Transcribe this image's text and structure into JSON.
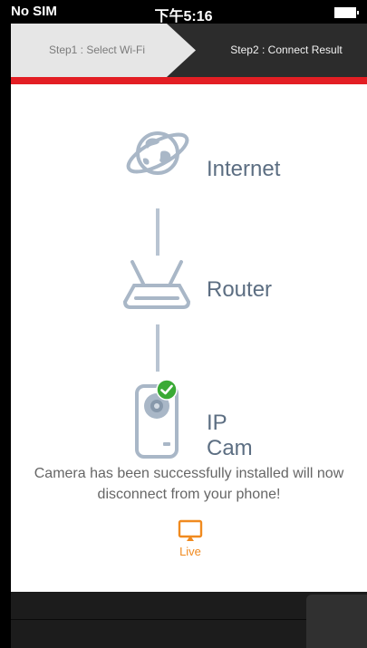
{
  "status_bar": {
    "carrier": "No SIM",
    "time": "下午5:16"
  },
  "steps": {
    "step1": "Step1 : Select Wi-Fi",
    "step2": "Step2 : Connect Result"
  },
  "diagram": {
    "internet": "Internet",
    "router": "Router",
    "ipcam": "IP Cam"
  },
  "message": "Camera has been successfully installed will now disconnect from your phone!",
  "live_button": {
    "label": "Live"
  },
  "colors": {
    "accent_red": "#e31e24",
    "icon_blue": "#a9b7c7",
    "live_orange": "#f08a1f",
    "success_green": "#3aaa35"
  }
}
